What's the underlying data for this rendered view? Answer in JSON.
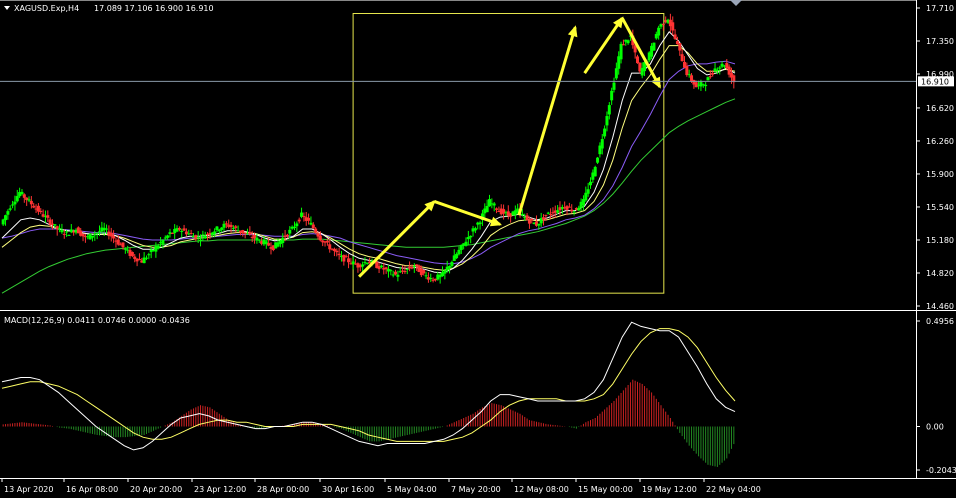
{
  "title": "XAGUSD.Exp,H4",
  "ohlc": "17.089 17.106 16.900 16.910",
  "current_price": "16.910",
  "macd_label": "MACD(12,26,9) 0.0411 0.0746 0.0000 -0.0436",
  "colors": {
    "background": "#000000",
    "axis": "#ffffff",
    "bull_candle": "#00ff00",
    "bear_candle": "#ff3333",
    "arrow": "#ffff33",
    "box": "#e6e64d",
    "ma_white": "#ffffff",
    "ma_yellow": "#ffff80",
    "ma_violet": "#8a5cf6",
    "ma_green": "#33cc33",
    "macd_pos": "#cc2222",
    "macd_neg": "#228822",
    "macd_line": "#ffffff",
    "signal_line": "#ffff66"
  },
  "chart_data": [
    {
      "type": "candlestick",
      "title": "XAGUSD.Exp,H4",
      "ylim": [
        14.46,
        17.71
      ],
      "price_ticks": [
        "17.710",
        "17.350",
        "16.990",
        "16.620",
        "16.260",
        "15.900",
        "15.540",
        "15.180",
        "14.820",
        "14.460"
      ],
      "x_labels": [
        "13 Apr 2020",
        "16 Apr 08:00",
        "20 Apr 20:00",
        "23 Apr 12:00",
        "28 Apr 00:00",
        "30 Apr 16:00",
        "5 May 04:00",
        "7 May 20:00",
        "12 May 08:00",
        "15 May 00:00",
        "19 May 12:00",
        "22 May 04:00"
      ],
      "close_approx": [
        15.35,
        15.55,
        15.7,
        15.6,
        15.5,
        15.4,
        15.3,
        15.25,
        15.3,
        15.2,
        15.25,
        15.3,
        15.2,
        15.1,
        15.0,
        14.95,
        15.05,
        15.15,
        15.25,
        15.3,
        15.25,
        15.2,
        15.25,
        15.3,
        15.35,
        15.3,
        15.25,
        15.2,
        15.15,
        15.1,
        15.2,
        15.3,
        15.45,
        15.35,
        15.2,
        15.1,
        15.0,
        14.95,
        14.9,
        14.95,
        14.9,
        14.85,
        14.8,
        14.85,
        14.9,
        14.8,
        14.75,
        14.8,
        14.95,
        15.1,
        15.25,
        15.4,
        15.6,
        15.5,
        15.45,
        15.5,
        15.4,
        15.35,
        15.45,
        15.5,
        15.55,
        15.5,
        15.6,
        15.9,
        16.3,
        16.8,
        17.3,
        17.4,
        17.0,
        17.2,
        17.5,
        17.6,
        17.3,
        17.0,
        16.85,
        16.9,
        17.05,
        17.1,
        16.91
      ],
      "ma_white": [
        15.2,
        15.3,
        15.4,
        15.42,
        15.4,
        15.35,
        15.3,
        15.28,
        15.27,
        15.25,
        15.24,
        15.25,
        15.23,
        15.18,
        15.12,
        15.08,
        15.08,
        15.1,
        15.15,
        15.2,
        15.22,
        15.22,
        15.23,
        15.25,
        15.28,
        15.28,
        15.27,
        15.24,
        15.2,
        15.17,
        15.18,
        15.22,
        15.3,
        15.3,
        15.25,
        15.18,
        15.1,
        15.03,
        14.98,
        14.96,
        14.94,
        14.91,
        14.88,
        14.87,
        14.88,
        14.86,
        14.83,
        14.82,
        14.87,
        14.96,
        15.08,
        15.22,
        15.38,
        15.43,
        15.44,
        15.46,
        15.43,
        15.4,
        15.42,
        15.46,
        15.5,
        15.5,
        15.55,
        15.7,
        15.95,
        16.3,
        16.7,
        17.0,
        17.0,
        17.1,
        17.3,
        17.45,
        17.35,
        17.2,
        17.05,
        16.98,
        17.0,
        17.05,
        17.0
      ],
      "ma_yellow": [
        15.1,
        15.18,
        15.26,
        15.32,
        15.34,
        15.33,
        15.3,
        15.28,
        15.27,
        15.25,
        15.24,
        15.24,
        15.23,
        15.2,
        15.16,
        15.12,
        15.1,
        15.1,
        15.12,
        15.16,
        15.18,
        15.2,
        15.21,
        15.23,
        15.25,
        15.26,
        15.26,
        15.25,
        15.22,
        15.19,
        15.19,
        15.21,
        15.26,
        15.27,
        15.25,
        15.2,
        15.14,
        15.08,
        15.03,
        15.0,
        14.98,
        14.95,
        14.92,
        14.9,
        14.9,
        14.88,
        14.86,
        14.85,
        14.87,
        14.92,
        15.0,
        15.1,
        15.23,
        15.3,
        15.35,
        15.39,
        15.4,
        15.39,
        15.4,
        15.43,
        15.46,
        15.47,
        15.5,
        15.6,
        15.78,
        16.05,
        16.4,
        16.7,
        16.85,
        16.98,
        17.15,
        17.3,
        17.3,
        17.22,
        17.1,
        17.02,
        17.02,
        17.04,
        17.02
      ],
      "ma_violet": [
        15.2,
        15.22,
        15.25,
        15.28,
        15.3,
        15.3,
        15.3,
        15.29,
        15.28,
        15.27,
        15.26,
        15.26,
        15.25,
        15.23,
        15.21,
        15.19,
        15.18,
        15.18,
        15.18,
        15.19,
        15.2,
        15.2,
        15.21,
        15.22,
        15.23,
        15.24,
        15.24,
        15.24,
        15.23,
        15.22,
        15.22,
        15.22,
        15.24,
        15.25,
        15.24,
        15.22,
        15.2,
        15.16,
        15.13,
        15.1,
        15.07,
        15.04,
        15.01,
        14.99,
        14.97,
        14.95,
        14.93,
        14.92,
        14.92,
        14.94,
        14.98,
        15.03,
        15.1,
        15.15,
        15.2,
        15.25,
        15.28,
        15.3,
        15.33,
        15.36,
        15.4,
        15.42,
        15.45,
        15.52,
        15.62,
        15.77,
        15.97,
        16.2,
        16.37,
        16.55,
        16.75,
        16.93,
        17.02,
        17.08,
        17.1,
        17.1,
        17.12,
        17.13,
        17.1
      ],
      "ma_green": [
        14.6,
        14.66,
        14.72,
        14.78,
        14.84,
        14.89,
        14.93,
        14.97,
        15.0,
        15.03,
        15.05,
        15.07,
        15.08,
        15.09,
        15.1,
        15.11,
        15.12,
        15.13,
        15.14,
        15.15,
        15.16,
        15.17,
        15.17,
        15.18,
        15.18,
        15.18,
        15.18,
        15.18,
        15.18,
        15.18,
        15.18,
        15.18,
        15.19,
        15.19,
        15.19,
        15.18,
        15.17,
        15.16,
        15.15,
        15.14,
        15.13,
        15.12,
        15.11,
        15.1,
        15.1,
        15.1,
        15.1,
        15.1,
        15.11,
        15.12,
        15.13,
        15.15,
        15.17,
        15.19,
        15.21,
        15.23,
        15.25,
        15.27,
        15.3,
        15.33,
        15.36,
        15.4,
        15.44,
        15.5,
        15.58,
        15.68,
        15.8,
        15.93,
        16.05,
        16.15,
        16.25,
        16.35,
        16.42,
        16.48,
        16.53,
        16.58,
        16.63,
        16.68,
        16.72
      ],
      "highlight_box": {
        "x0": 38,
        "x1": 70,
        "y0": 14.6,
        "y1": 17.65
      },
      "arrows": [
        {
          "from": [
            38,
            14.78
          ],
          "to": [
            46,
            15.6
          ]
        },
        {
          "from": [
            46,
            15.6
          ],
          "to": [
            53,
            15.35
          ]
        },
        {
          "from": [
            55,
            15.45
          ],
          "to": [
            61,
            17.5
          ]
        },
        {
          "from": [
            62,
            17.0
          ],
          "to": [
            66,
            17.6
          ]
        },
        {
          "from": [
            66,
            17.6
          ],
          "to": [
            70,
            16.85
          ]
        }
      ]
    },
    {
      "type": "bar",
      "title": "MACD(12,26,9) 0.0411 0.0746 0.0000 -0.0436",
      "ylim": [
        -0.2043,
        0.4956
      ],
      "y_ticks": [
        "0.4956",
        "0.00",
        "-0.2043"
      ],
      "histogram_approx": [
        0.01,
        0.015,
        0.02,
        0.015,
        0.01,
        0.005,
        -0.005,
        -0.01,
        -0.02,
        -0.03,
        -0.04,
        -0.045,
        -0.05,
        -0.05,
        -0.045,
        -0.04,
        -0.02,
        0.0,
        0.02,
        0.05,
        0.08,
        0.1,
        0.09,
        0.06,
        0.03,
        0.01,
        -0.005,
        -0.01,
        -0.005,
        0.0,
        0.005,
        0.01,
        0.02,
        0.02,
        0.01,
        0.0,
        -0.01,
        -0.03,
        -0.05,
        -0.07,
        -0.07,
        -0.06,
        -0.05,
        -0.04,
        -0.03,
        -0.02,
        -0.01,
        0.0,
        0.02,
        0.04,
        0.06,
        0.09,
        0.11,
        0.1,
        0.08,
        0.06,
        0.03,
        0.02,
        0.01,
        0.005,
        0.0,
        -0.01,
        0.02,
        0.04,
        0.08,
        0.12,
        0.17,
        0.22,
        0.2,
        0.16,
        0.1,
        0.04,
        -0.03,
        -0.09,
        -0.14,
        -0.18,
        -0.19,
        -0.15,
        -0.06
      ],
      "macd_approx": [
        0.21,
        0.22,
        0.23,
        0.23,
        0.22,
        0.19,
        0.16,
        0.12,
        0.08,
        0.04,
        0.0,
        -0.03,
        -0.06,
        -0.09,
        -0.11,
        -0.1,
        -0.07,
        -0.03,
        0.01,
        0.04,
        0.05,
        0.06,
        0.05,
        0.03,
        0.02,
        0.01,
        0.0,
        -0.01,
        -0.01,
        0.0,
        0.0,
        0.01,
        0.02,
        0.02,
        0.01,
        -0.01,
        -0.03,
        -0.05,
        -0.07,
        -0.08,
        -0.09,
        -0.08,
        -0.08,
        -0.08,
        -0.08,
        -0.08,
        -0.07,
        -0.06,
        -0.04,
        -0.01,
        0.03,
        0.07,
        0.12,
        0.15,
        0.15,
        0.14,
        0.13,
        0.12,
        0.12,
        0.12,
        0.12,
        0.12,
        0.13,
        0.16,
        0.22,
        0.32,
        0.42,
        0.49,
        0.47,
        0.46,
        0.45,
        0.45,
        0.42,
        0.35,
        0.28,
        0.2,
        0.13,
        0.09,
        0.07
      ],
      "signal_approx": [
        0.18,
        0.19,
        0.2,
        0.21,
        0.21,
        0.2,
        0.19,
        0.17,
        0.15,
        0.12,
        0.09,
        0.06,
        0.03,
        0.0,
        -0.03,
        -0.05,
        -0.06,
        -0.06,
        -0.05,
        -0.03,
        -0.01,
        0.01,
        0.02,
        0.03,
        0.03,
        0.02,
        0.02,
        0.01,
        0.0,
        0.0,
        0.0,
        0.0,
        0.01,
        0.01,
        0.01,
        0.01,
        0.0,
        -0.01,
        -0.02,
        -0.04,
        -0.05,
        -0.06,
        -0.07,
        -0.07,
        -0.07,
        -0.07,
        -0.07,
        -0.07,
        -0.06,
        -0.05,
        -0.03,
        0.0,
        0.03,
        0.07,
        0.1,
        0.12,
        0.13,
        0.13,
        0.13,
        0.13,
        0.12,
        0.12,
        0.12,
        0.13,
        0.15,
        0.2,
        0.27,
        0.34,
        0.4,
        0.44,
        0.46,
        0.46,
        0.45,
        0.42,
        0.37,
        0.3,
        0.23,
        0.17,
        0.12
      ]
    }
  ]
}
